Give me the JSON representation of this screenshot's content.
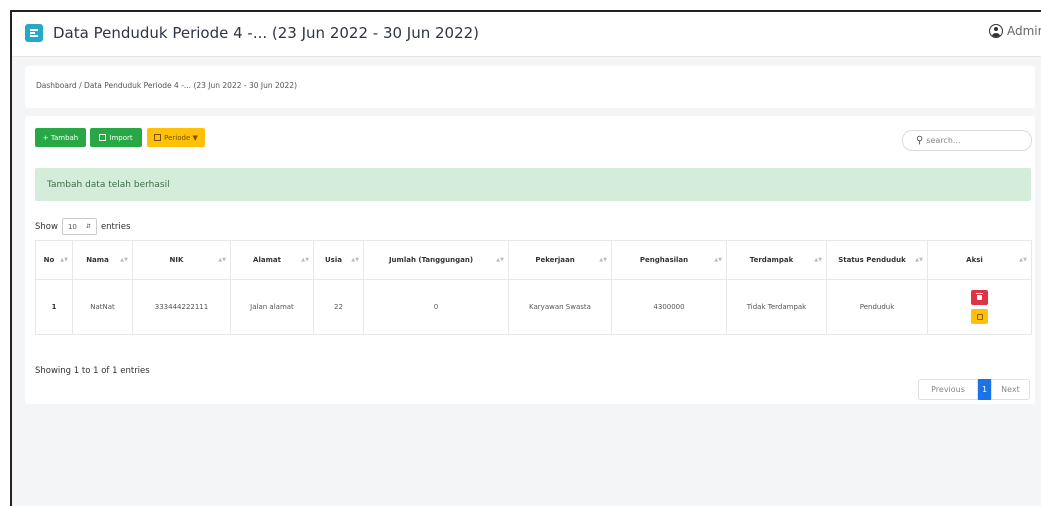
{
  "header": {
    "title": "Data Penduduk Periode 4 -... (23 Jun 2022 - 30 Jun 2022)",
    "user": "Admin"
  },
  "breadcrumb": "Dashboard / Data Penduduk Periode 4 -... (23 Jun 2022 - 30 Jun 2022)",
  "toolbar": {
    "add_label": "+ Tambah",
    "import_label": "Import",
    "period_label": "Periode ▼",
    "search_placeholder": "search..."
  },
  "alert": "Tambah data telah berhasil",
  "show": {
    "prefix": "Show",
    "value": "10",
    "suffix": "entries"
  },
  "table": {
    "columns": [
      "No",
      "Nama",
      "NIK",
      "Alamat",
      "Usia",
      "Jumlah (Tanggungan)",
      "Pekerjaan",
      "Penghasilan",
      "Terdampak",
      "Status Penduduk",
      "Aksi"
    ],
    "rows": [
      [
        "1",
        "NatNat",
        "333444222111",
        "Jalan alamat",
        "22",
        "0",
        "Karyawan Swasta",
        "4300000",
        "Tidak Terdampak",
        "Penduduk"
      ]
    ]
  },
  "info": "Showing 1 to 1 of 1 entries",
  "pagination": {
    "previous": "Previous",
    "current": "1",
    "next": "Next"
  },
  "colors": {
    "accent": "#26a8c9",
    "success": "#28a745",
    "warning": "#ffc107",
    "danger": "#dc3545",
    "primary": "#1a73e8",
    "alert_bg": "#d4edda"
  }
}
